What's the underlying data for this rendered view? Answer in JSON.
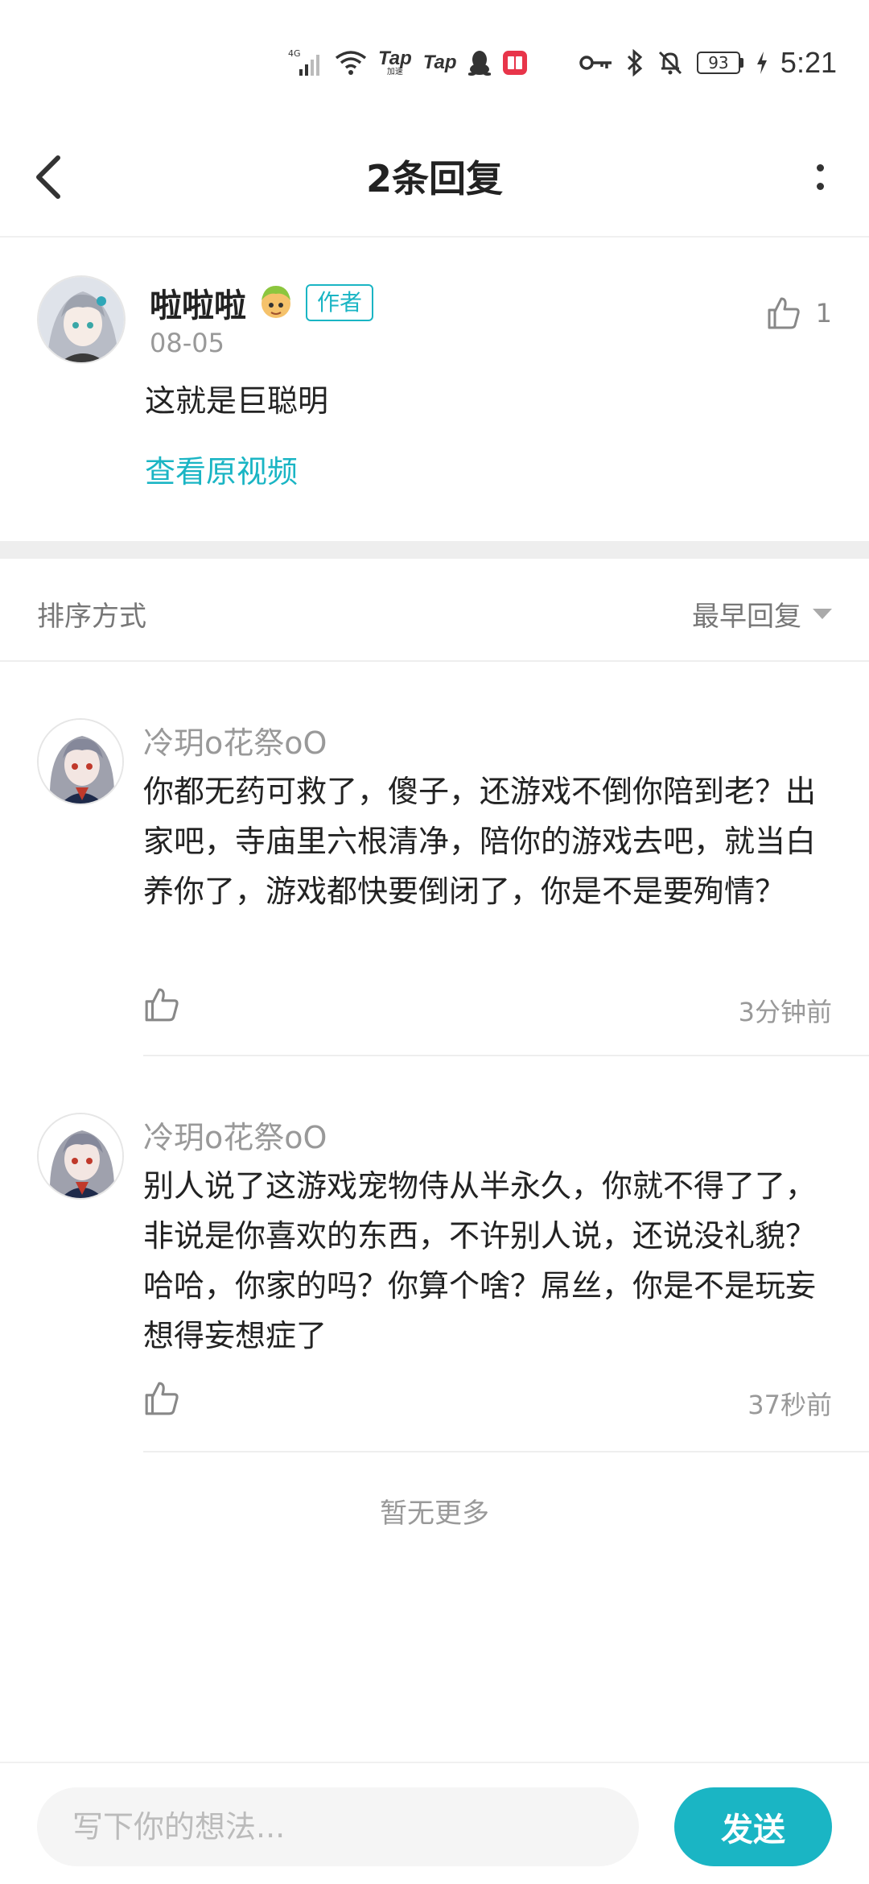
{
  "status_bar": {
    "network": "4G",
    "tap_label_1": "Tap",
    "tap_sub_1": "加速",
    "tap_label_2": "Tap",
    "battery": "93",
    "time": "5:21"
  },
  "header": {
    "title": "2条回复"
  },
  "post": {
    "author": "啦啦啦",
    "author_badge": "作者",
    "date": "08-05",
    "like_count": "1",
    "content": "这就是巨聪明",
    "view_video": "查看原视频"
  },
  "sort": {
    "label": "排序方式",
    "value": "最早回复"
  },
  "replies": [
    {
      "name": "冷玥o花祭oO",
      "text": "你都无药可救了，傻子，还游戏不倒你陪到老？出家吧，寺庙里六根清净，陪你的游戏去吧，就当白养你了，游戏都快要倒闭了，你是不是要殉情？",
      "time": "3分钟前"
    },
    {
      "name": "冷玥o花祭oO",
      "text": "别人说了这游戏宠物侍从半永久，你就不得了了，非说是你喜欢的东西，不许别人说，还说没礼貌？哈哈，你家的吗？你算个啥？屌丝，你是不是玩妄想得妄想症了",
      "time": "37秒前"
    }
  ],
  "no_more": "暂无更多",
  "input": {
    "placeholder": "写下你的想法...",
    "send_label": "发送"
  },
  "colors": {
    "accent": "#1ab5c4",
    "muted_text": "#999999",
    "divider": "#eeeeee"
  }
}
